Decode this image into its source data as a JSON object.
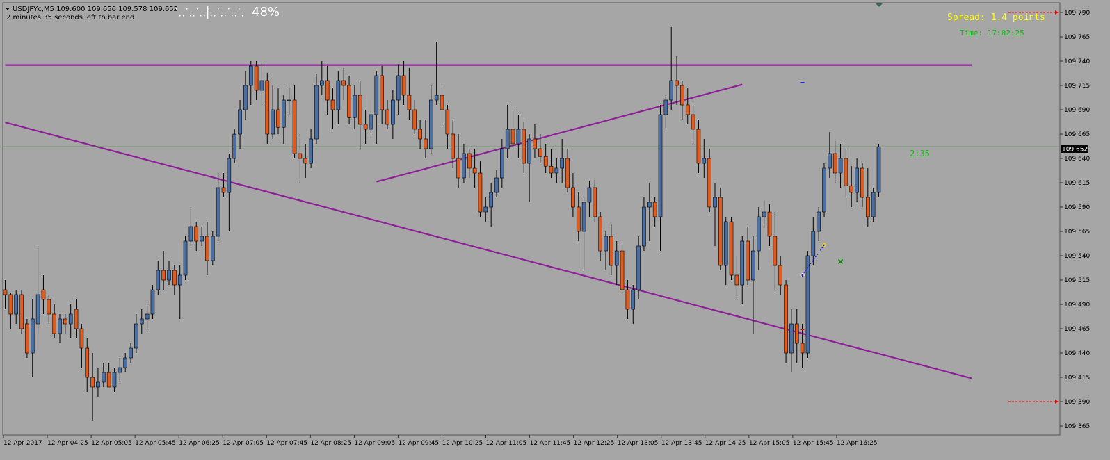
{
  "header": {
    "symbol_line": "USDJPYc,M5  109.600 109.656 109.578 109.652",
    "countdown": "2 minutes 35 seconds left to bar end",
    "progress_text": "48%",
    "progress_value": 0.48,
    "menu_arrow_icon": "triangle-down-icon"
  },
  "overlay": {
    "spread_text": "Spread: 1.4 points",
    "time_text": "Time: 17:02:25",
    "bar_timer": "2:35"
  },
  "colors": {
    "background": "#a6a6a6",
    "bull_candle": "#4a6fa5",
    "bear_candle": "#e25a1c",
    "wick": "#000000",
    "trendline": "#8e1f98",
    "spread_text": "#ffff00",
    "time_text": "#00c800",
    "alert_line": "#ff0000",
    "current_price_line": "#4a6a4a"
  },
  "chart_data": {
    "type": "candlestick",
    "symbol": "USDJPYc",
    "timeframe": "M5",
    "current_price": "109.652",
    "current_price_value": 109.652,
    "ylim": [
      109.357,
      109.8
    ],
    "y_ticks": [
      "109.790",
      "109.765",
      "109.740",
      "109.715",
      "109.690",
      "109.665",
      "109.640",
      "109.615",
      "109.590",
      "109.565",
      "109.540",
      "109.515",
      "109.490",
      "109.465",
      "109.440",
      "109.415",
      "109.390",
      "109.365"
    ],
    "x_ticks": [
      "12 Apr 2017",
      "12 Apr 04:25",
      "12 Apr 05:05",
      "12 Apr 05:45",
      "12 Apr 06:25",
      "12 Apr 07:05",
      "12 Apr 07:45",
      "12 Apr 08:25",
      "12 Apr 09:05",
      "12 Apr 09:45",
      "12 Apr 10:25",
      "12 Apr 11:05",
      "12 Apr 11:45",
      "12 Apr 12:25",
      "12 Apr 13:05",
      "12 Apr 13:45",
      "12 Apr 14:25",
      "12 Apr 15:05",
      "12 Apr 15:45",
      "12 Apr 16:25"
    ],
    "alert_levels": [
      109.79,
      109.39
    ],
    "trendlines": [
      {
        "i0": 0,
        "p0": 109.736,
        "i1": 177,
        "p1": 109.736
      },
      {
        "i0": 0,
        "p0": 109.677,
        "i1": 177,
        "p1": 109.414
      },
      {
        "i0": 68,
        "p0": 109.616,
        "i1": 135,
        "p1": 109.716
      }
    ],
    "markers": [
      {
        "type": "sell_open",
        "i": 146,
        "p": 109.718
      },
      {
        "type": "sell_sl",
        "i": 146,
        "p": 109.464
      },
      {
        "type": "buy_arrow",
        "i": 146,
        "p": 109.52
      },
      {
        "type": "close_diamond",
        "i": 150,
        "p": 109.551
      },
      {
        "type": "close_cross",
        "i": 153,
        "p": 109.534
      }
    ],
    "candles": [
      [
        109.505,
        109.515,
        109.485,
        109.5
      ],
      [
        109.5,
        109.502,
        109.465,
        109.48
      ],
      [
        109.48,
        109.505,
        109.47,
        109.5
      ],
      [
        109.5,
        109.505,
        109.46,
        109.465
      ],
      [
        109.47,
        109.475,
        109.435,
        109.44
      ],
      [
        109.44,
        109.495,
        109.415,
        109.475
      ],
      [
        109.47,
        109.55,
        109.46,
        109.5
      ],
      [
        109.505,
        109.52,
        109.48,
        109.495
      ],
      [
        109.495,
        109.5,
        109.47,
        109.48
      ],
      [
        109.48,
        109.49,
        109.455,
        109.46
      ],
      [
        109.46,
        109.48,
        109.45,
        109.475
      ],
      [
        109.475,
        109.48,
        109.46,
        109.47
      ],
      [
        109.47,
        109.49,
        109.455,
        109.48
      ],
      [
        109.485,
        109.495,
        109.455,
        109.465
      ],
      [
        109.465,
        109.47,
        109.425,
        109.445
      ],
      [
        109.445,
        109.455,
        109.4,
        109.415
      ],
      [
        109.415,
        109.44,
        109.37,
        109.405
      ],
      [
        109.405,
        109.425,
        109.395,
        109.41
      ],
      [
        109.41,
        109.43,
        109.405,
        109.42
      ],
      [
        109.42,
        109.43,
        109.405,
        109.405
      ],
      [
        109.405,
        109.425,
        109.4,
        109.42
      ],
      [
        109.42,
        109.435,
        109.41,
        109.425
      ],
      [
        109.425,
        109.44,
        109.42,
        109.435
      ],
      [
        109.435,
        109.45,
        109.43,
        109.445
      ],
      [
        109.445,
        109.48,
        109.44,
        109.47
      ],
      [
        109.47,
        109.485,
        109.46,
        109.475
      ],
      [
        109.475,
        109.49,
        109.465,
        109.48
      ],
      [
        109.48,
        109.51,
        109.475,
        109.505
      ],
      [
        109.505,
        109.535,
        109.5,
        109.525
      ],
      [
        109.525,
        109.545,
        109.505,
        109.515
      ],
      [
        109.515,
        109.535,
        109.51,
        109.525
      ],
      [
        109.525,
        109.53,
        109.5,
        109.51
      ],
      [
        109.51,
        109.53,
        109.475,
        109.52
      ],
      [
        109.52,
        109.56,
        109.515,
        109.555
      ],
      [
        109.555,
        109.59,
        109.55,
        109.57
      ],
      [
        109.57,
        109.575,
        109.545,
        109.555
      ],
      [
        109.555,
        109.57,
        109.55,
        109.56
      ],
      [
        109.56,
        109.575,
        109.52,
        109.535
      ],
      [
        109.535,
        109.565,
        109.53,
        109.56
      ],
      [
        109.56,
        109.625,
        109.555,
        109.61
      ],
      [
        109.61,
        109.625,
        109.6,
        109.605
      ],
      [
        109.605,
        109.645,
        109.565,
        109.64
      ],
      [
        109.64,
        109.67,
        109.635,
        109.665
      ],
      [
        109.665,
        109.7,
        109.65,
        109.69
      ],
      [
        109.69,
        109.73,
        109.68,
        109.715
      ],
      [
        109.715,
        109.74,
        109.695,
        109.735
      ],
      [
        109.735,
        109.74,
        109.7,
        109.71
      ],
      [
        109.71,
        109.74,
        109.695,
        109.72
      ],
      [
        109.72,
        109.728,
        109.655,
        109.665
      ],
      [
        109.665,
        109.715,
        109.66,
        109.69
      ],
      [
        109.69,
        109.712,
        109.665,
        109.672
      ],
      [
        109.672,
        109.705,
        109.655,
        109.7
      ],
      [
        109.7,
        109.712,
        109.685,
        109.7
      ],
      [
        109.7,
        109.715,
        109.64,
        109.645
      ],
      [
        109.645,
        109.665,
        109.615,
        109.64
      ],
      [
        109.64,
        109.655,
        109.62,
        109.635
      ],
      [
        109.635,
        109.67,
        109.63,
        109.66
      ],
      [
        109.66,
        109.727,
        109.655,
        109.715
      ],
      [
        109.715,
        109.74,
        109.705,
        109.72
      ],
      [
        109.72,
        109.735,
        109.685,
        109.7
      ],
      [
        109.7,
        109.712,
        109.67,
        109.69
      ],
      [
        109.69,
        109.73,
        109.675,
        109.72
      ],
      [
        109.72,
        109.733,
        109.7,
        109.715
      ],
      [
        109.715,
        109.725,
        109.675,
        109.682
      ],
      [
        109.682,
        109.715,
        109.67,
        109.705
      ],
      [
        109.705,
        109.72,
        109.65,
        109.675
      ],
      [
        109.675,
        109.69,
        109.655,
        109.67
      ],
      [
        109.67,
        109.7,
        109.665,
        109.685
      ],
      [
        109.685,
        109.73,
        109.655,
        109.725
      ],
      [
        109.725,
        109.735,
        109.675,
        109.69
      ],
      [
        109.69,
        109.7,
        109.67,
        109.675
      ],
      [
        109.675,
        109.71,
        109.66,
        109.7
      ],
      [
        109.7,
        109.737,
        109.685,
        109.725
      ],
      [
        109.725,
        109.74,
        109.695,
        109.705
      ],
      [
        109.705,
        109.733,
        109.68,
        109.69
      ],
      [
        109.69,
        109.7,
        109.665,
        109.67
      ],
      [
        109.67,
        109.68,
        109.65,
        109.66
      ],
      [
        109.66,
        109.68,
        109.64,
        109.65
      ],
      [
        109.65,
        109.715,
        109.645,
        109.7
      ],
      [
        109.7,
        109.76,
        109.695,
        109.705
      ],
      [
        109.705,
        109.717,
        109.675,
        109.69
      ],
      [
        109.69,
        109.695,
        109.65,
        109.665
      ],
      [
        109.665,
        109.68,
        109.63,
        109.64
      ],
      [
        109.64,
        109.665,
        109.61,
        109.62
      ],
      [
        109.62,
        109.655,
        109.615,
        109.645
      ],
      [
        109.645,
        109.65,
        109.62,
        109.63
      ],
      [
        109.63,
        109.65,
        109.61,
        109.625
      ],
      [
        109.625,
        109.637,
        109.58,
        109.585
      ],
      [
        109.585,
        109.6,
        109.575,
        109.59
      ],
      [
        109.59,
        109.615,
        109.57,
        109.605
      ],
      [
        109.605,
        109.628,
        109.6,
        109.62
      ],
      [
        109.62,
        109.66,
        109.61,
        109.65
      ],
      [
        109.65,
        109.695,
        109.64,
        109.67
      ],
      [
        109.67,
        109.69,
        109.65,
        109.655
      ],
      [
        109.655,
        109.685,
        109.64,
        109.67
      ],
      [
        109.67,
        109.678,
        109.625,
        109.635
      ],
      [
        109.635,
        109.665,
        109.595,
        109.66
      ],
      [
        109.66,
        109.675,
        109.64,
        109.65
      ],
      [
        109.65,
        109.665,
        109.635,
        109.642
      ],
      [
        109.642,
        109.655,
        109.625,
        109.632
      ],
      [
        109.632,
        109.65,
        109.62,
        109.625
      ],
      [
        109.625,
        109.64,
        109.615,
        109.63
      ],
      [
        109.63,
        109.66,
        109.615,
        109.64
      ],
      [
        109.64,
        109.65,
        109.605,
        109.61
      ],
      [
        109.61,
        109.625,
        109.58,
        109.59
      ],
      [
        109.59,
        109.605,
        109.555,
        109.565
      ],
      [
        109.565,
        109.6,
        109.525,
        109.595
      ],
      [
        109.595,
        109.617,
        109.58,
        109.61
      ],
      [
        109.61,
        109.618,
        109.575,
        109.58
      ],
      [
        109.58,
        109.585,
        109.535,
        109.545
      ],
      [
        109.545,
        109.565,
        109.525,
        109.56
      ],
      [
        109.56,
        109.572,
        109.52,
        109.53
      ],
      [
        109.53,
        109.555,
        109.51,
        109.545
      ],
      [
        109.545,
        109.552,
        109.5,
        109.505
      ],
      [
        109.505,
        109.515,
        109.475,
        109.485
      ],
      [
        109.485,
        109.51,
        109.47,
        109.505
      ],
      [
        109.505,
        109.56,
        109.495,
        109.55
      ],
      [
        109.55,
        109.6,
        109.545,
        109.59
      ],
      [
        109.59,
        109.615,
        109.555,
        109.595
      ],
      [
        109.595,
        109.6,
        109.57,
        109.58
      ],
      [
        109.58,
        109.695,
        109.545,
        109.685
      ],
      [
        109.685,
        109.705,
        109.67,
        109.7
      ],
      [
        109.7,
        109.775,
        109.69,
        109.72
      ],
      [
        109.72,
        109.745,
        109.695,
        109.715
      ],
      [
        109.715,
        109.72,
        109.68,
        109.695
      ],
      [
        109.695,
        109.712,
        109.675,
        109.685
      ],
      [
        109.685,
        109.695,
        109.655,
        109.67
      ],
      [
        109.67,
        109.68,
        109.625,
        109.635
      ],
      [
        109.635,
        109.66,
        109.62,
        109.64
      ],
      [
        109.64,
        109.65,
        109.585,
        109.59
      ],
      [
        109.59,
        109.615,
        109.55,
        109.6
      ],
      [
        109.6,
        109.61,
        109.525,
        109.53
      ],
      [
        109.53,
        109.58,
        109.51,
        109.575
      ],
      [
        109.575,
        109.58,
        109.515,
        109.52
      ],
      [
        109.52,
        109.54,
        109.495,
        109.51
      ],
      [
        109.51,
        109.56,
        109.49,
        109.555
      ],
      [
        109.555,
        109.57,
        109.51,
        109.515
      ],
      [
        109.515,
        109.56,
        109.46,
        109.545
      ],
      [
        109.545,
        109.59,
        109.525,
        109.58
      ],
      [
        109.58,
        109.597,
        109.57,
        109.585
      ],
      [
        109.585,
        109.593,
        109.55,
        109.56
      ],
      [
        109.56,
        109.585,
        109.505,
        109.53
      ],
      [
        109.53,
        109.54,
        109.5,
        109.51
      ],
      [
        109.51,
        109.515,
        109.43,
        109.44
      ],
      [
        109.44,
        109.485,
        109.42,
        109.47
      ],
      [
        109.47,
        109.485,
        109.43,
        109.45
      ],
      [
        109.45,
        109.47,
        109.425,
        109.44
      ],
      [
        109.44,
        109.545,
        109.435,
        109.54
      ],
      [
        109.54,
        109.58,
        109.53,
        109.565
      ],
      [
        109.565,
        109.59,
        109.555,
        109.585
      ],
      [
        109.585,
        109.635,
        109.58,
        109.63
      ],
      [
        109.63,
        109.667,
        109.62,
        109.645
      ],
      [
        109.645,
        109.658,
        109.615,
        109.625
      ],
      [
        109.625,
        109.655,
        109.61,
        109.64
      ],
      [
        109.64,
        109.65,
        109.6,
        109.612
      ],
      [
        109.612,
        109.632,
        109.59,
        109.605
      ],
      [
        109.605,
        109.64,
        109.595,
        109.63
      ],
      [
        109.63,
        109.635,
        109.59,
        109.6
      ],
      [
        109.6,
        109.63,
        109.57,
        109.58
      ],
      [
        109.58,
        109.61,
        109.575,
        109.605
      ],
      [
        109.605,
        109.655,
        109.6,
        109.652
      ]
    ]
  }
}
